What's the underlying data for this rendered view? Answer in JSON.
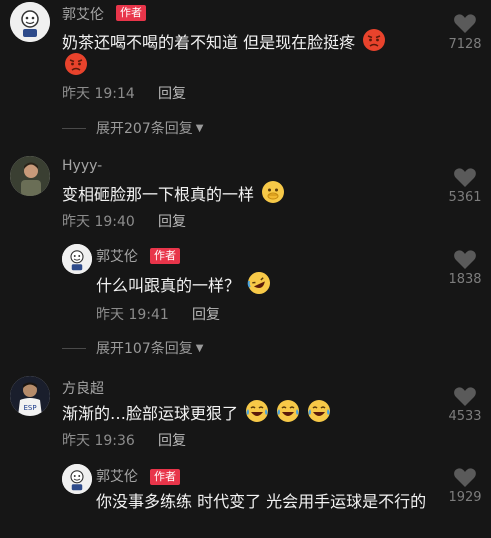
{
  "comments": [
    {
      "id": "c1",
      "name": "郭艾伦",
      "badge": "作者",
      "text": "奶茶还喝不喝的着不知道 但是现在脸挺疼",
      "emoji_icons": [
        "pouting-face-icon",
        "pouting-face-icon"
      ],
      "time": "昨天 19:14",
      "reply_label": "回复",
      "likes": "7128",
      "expand_label": "展开207条回复"
    },
    {
      "id": "c2",
      "name": "Hyyy-",
      "text": "变相砸脸那一下根真的一样",
      "emoji_icons": [
        "hand-over-face-icon"
      ],
      "time": "昨天 19:40",
      "reply_label": "回复",
      "likes": "5361"
    },
    {
      "id": "c2r1",
      "name": "郭艾伦",
      "badge": "作者",
      "text": "什么叫跟真的一样？",
      "emoji_icons": [
        "rolling-laughing-face-icon"
      ],
      "time": "昨天 19:41",
      "reply_label": "回复",
      "likes": "1838",
      "expand_label": "展开107条回复"
    },
    {
      "id": "c3",
      "name": "方良超",
      "text": "渐渐的…脸部运球更狠了",
      "emoji_icons": [
        "crying-laughing-face-icon",
        "crying-laughing-face-icon",
        "crying-laughing-face-icon"
      ],
      "time": "昨天 19:36",
      "reply_label": "回复",
      "likes": "4533"
    },
    {
      "id": "c3r1",
      "name": "郭艾伦",
      "badge": "作者",
      "text": "你没事多练练 时代变了 光会用手运球是不行的",
      "likes": "1929"
    }
  ],
  "colors": {
    "background": "#161616",
    "author_badge": "#e8354a",
    "heart": "#5a5a5a"
  }
}
